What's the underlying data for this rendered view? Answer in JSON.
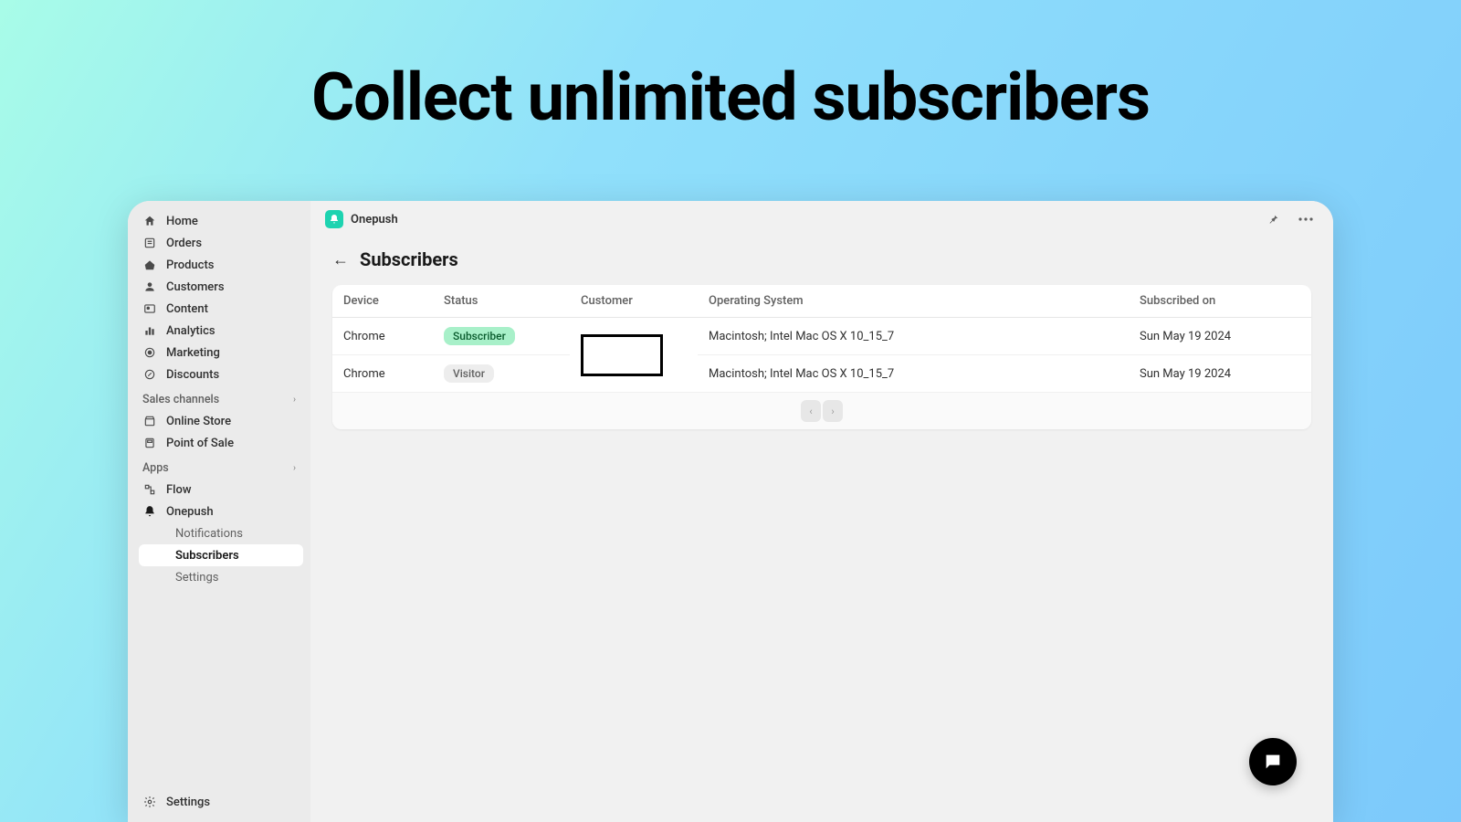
{
  "hero": {
    "title": "Collect unlimited subscribers"
  },
  "sidebar": {
    "nav": [
      {
        "label": "Home",
        "icon": "home"
      },
      {
        "label": "Orders",
        "icon": "orders"
      },
      {
        "label": "Products",
        "icon": "products"
      },
      {
        "label": "Customers",
        "icon": "customers"
      },
      {
        "label": "Content",
        "icon": "content"
      },
      {
        "label": "Analytics",
        "icon": "analytics"
      },
      {
        "label": "Marketing",
        "icon": "marketing"
      },
      {
        "label": "Discounts",
        "icon": "discounts"
      }
    ],
    "sales_header": "Sales channels",
    "sales": [
      {
        "label": "Online Store",
        "icon": "store"
      },
      {
        "label": "Point of Sale",
        "icon": "pos"
      }
    ],
    "apps_header": "Apps",
    "apps": [
      {
        "label": "Flow",
        "icon": "flow"
      },
      {
        "label": "Onepush",
        "icon": "bell"
      }
    ],
    "onepush_sub": [
      {
        "label": "Notifications",
        "active": false
      },
      {
        "label": "Subscribers",
        "active": true
      },
      {
        "label": "Settings",
        "active": false
      }
    ],
    "footer": {
      "label": "Settings",
      "icon": "gear"
    }
  },
  "topbar": {
    "app_name": "Onepush"
  },
  "page": {
    "title": "Subscribers"
  },
  "table": {
    "headers": [
      "Device",
      "Status",
      "Customer",
      "Operating System",
      "Subscribed on"
    ],
    "rows": [
      {
        "device": "Chrome",
        "status": "Subscriber",
        "status_kind": "subscriber",
        "os": "Macintosh; Intel Mac OS X 10_15_7",
        "subscribed": "Sun May 19 2024"
      },
      {
        "device": "Chrome",
        "status": "Visitor",
        "status_kind": "visitor",
        "os": "Macintosh; Intel Mac OS X 10_15_7",
        "subscribed": "Sun May 19 2024"
      }
    ]
  }
}
